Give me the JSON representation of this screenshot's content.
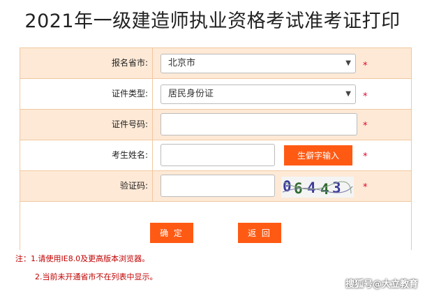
{
  "page_title": "2021年一级建造师执业资格考试准考证打印",
  "form": {
    "province": {
      "label": "报名省市:",
      "value": "北京市"
    },
    "id_type": {
      "label": "证件类型:",
      "value": "居民身份证"
    },
    "id_number": {
      "label": "证件号码:",
      "value": "",
      "placeholder": ""
    },
    "name": {
      "label": "考生姓名:",
      "value": "",
      "rare_char_button": "生僻字输入"
    },
    "captcha": {
      "label": "验证码:",
      "value": "",
      "image_text": [
        "0",
        "6",
        "4",
        "4",
        "3"
      ]
    },
    "required_mark": "*"
  },
  "buttons": {
    "confirm": "确 定",
    "back": "返 回"
  },
  "notes": [
    "注：1.请使用IE8.0及更高版本浏览器。",
    "2.当前未开通省市不在列表中显示。"
  ],
  "watermark": "搜狐号@大立教育",
  "colors": {
    "accent": "#ff5a14",
    "row_alt": "#fde9d6",
    "border": "#f0c8a0",
    "required": "#e4002b"
  }
}
